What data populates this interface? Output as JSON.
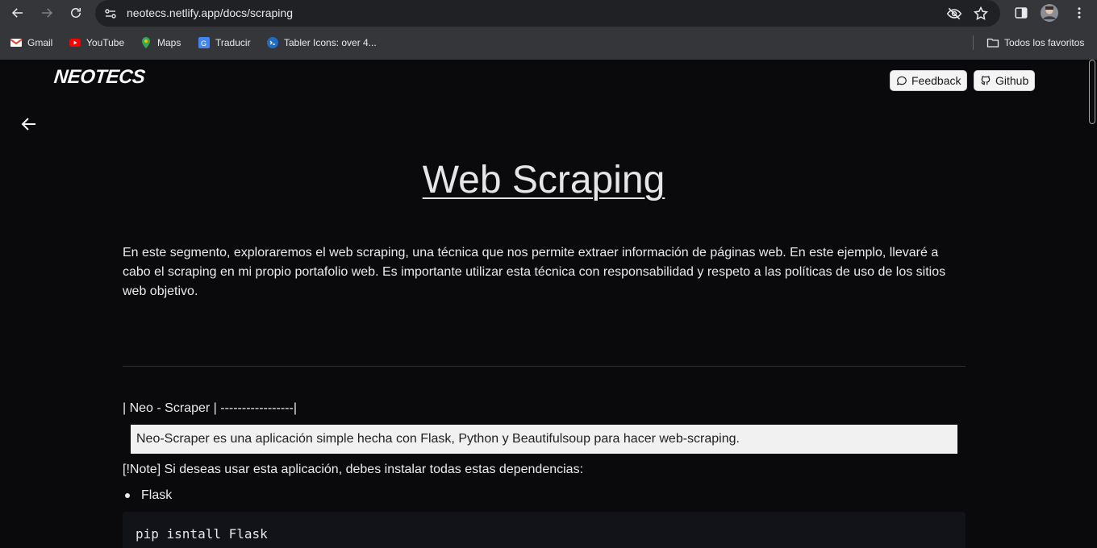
{
  "browser": {
    "url": "neotecs.netlify.app/docs/scraping",
    "bookmarks": [
      {
        "label": "Gmail",
        "icon": "gmail-icon",
        "color": "#ea4335"
      },
      {
        "label": "YouTube",
        "icon": "youtube-icon",
        "color": "#ff0000"
      },
      {
        "label": "Maps",
        "icon": "maps-icon",
        "color": "#34a853"
      },
      {
        "label": "Traducir",
        "icon": "translate-icon",
        "color": "#4285f4"
      },
      {
        "label": "Tabler Icons: over 4...",
        "icon": "tabler-icon",
        "color": "#206bc4"
      }
    ],
    "all_bookmarks": "Todos los favoritos"
  },
  "header": {
    "logo": "NEOTECS",
    "feedback_label": "Feedback",
    "github_label": "Github"
  },
  "content": {
    "title": "Web Scraping",
    "intro": "En este segmento, exploraremos el web scraping, una técnica que nos permite extraer información de páginas web. En este ejemplo, llevaré a cabo el scraping en mi propio portafolio web. Es importante utilizar esta técnica con responsabilidad y respeto a las políticas de uso de los sitios web objetivo.",
    "heading": "| Neo - Scraper | -----------------|",
    "quote": "Neo-Scraper es una aplicación simple hecha con Flask, Python y Beautifulsoup para hacer web-scraping.",
    "note": "[!Note] Si deseas usar esta aplicación, debes instalar todas estas dependencias:",
    "list": [
      "Flask"
    ],
    "code": "pip isntall Flask"
  },
  "colors": {
    "background": "#0a0a0c",
    "browser_chrome": "#35363a",
    "address_bar": "#202124",
    "quote_bg": "#f1f1f1",
    "code_bg": "#111319"
  }
}
